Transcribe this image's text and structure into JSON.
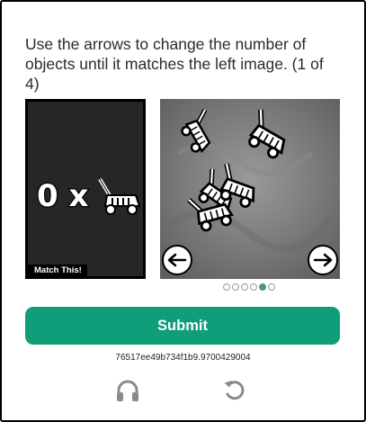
{
  "challenge": {
    "instructions": "Use the arrows to change the number of objects until it matches the left image. (1 of 4)",
    "left_image": {
      "count_text": "0 x",
      "object": "lawnmower",
      "match_label": "Match This!"
    },
    "right_image": {
      "object": "lawnmower",
      "visible_count": 5,
      "prev_icon": "arrow-left-icon",
      "next_icon": "arrow-right-icon"
    },
    "pagination": {
      "total": 6,
      "active_index": 4
    },
    "submit_label": "Submit",
    "session_id": "76517ee49b734f1b9.9700429004",
    "footer": {
      "audio_icon": "headphones-icon",
      "reload_icon": "reload-icon"
    }
  },
  "colors": {
    "accent": "#0f9d7a",
    "active_dot": "#4c9a6a",
    "footer_icon": "#8a8a8a"
  }
}
